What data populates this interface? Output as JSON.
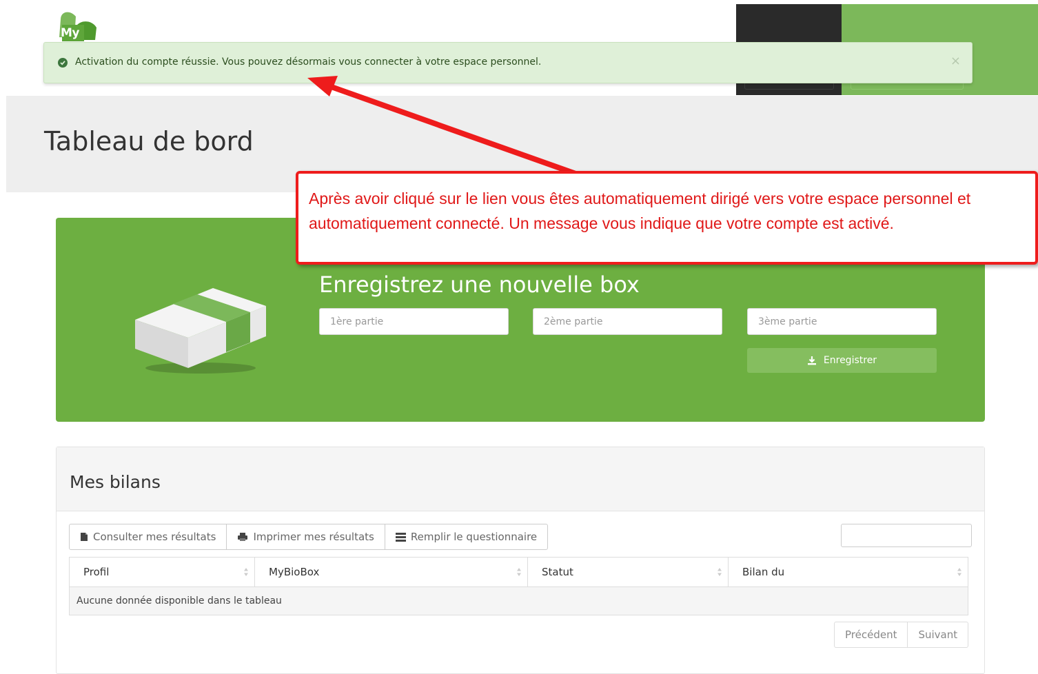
{
  "header": {
    "logo_text": "My"
  },
  "alert": {
    "icon": "check-circle-icon",
    "message": "Activation du compte réussie. Vous pouvez désormais vous connecter à votre espace personnel.",
    "close_label": "×"
  },
  "page": {
    "title": "Tableau de bord"
  },
  "register_box": {
    "title": "Enregistrez une nouvelle box",
    "inputs": [
      {
        "placeholder": "1ère partie",
        "value": ""
      },
      {
        "placeholder": "2ème partie",
        "value": ""
      },
      {
        "placeholder": "3ème partie",
        "value": ""
      }
    ],
    "submit_icon": "download-icon",
    "submit_label": "Enregistrer"
  },
  "callout": {
    "text": "Après avoir cliqué sur le lien vous êtes automatiquement dirigé vers votre espace personnel et automatiquement connecté. Un message vous indique que votre compte est activé."
  },
  "bilans": {
    "title": "Mes bilans",
    "toolbar": [
      {
        "icon": "file-icon",
        "label": "Consulter mes résultats"
      },
      {
        "icon": "print-icon",
        "label": "Imprimer mes résultats"
      },
      {
        "icon": "list-icon",
        "label": "Remplir le questionnaire"
      }
    ],
    "search_value": "",
    "columns": [
      "Profil",
      "MyBioBox",
      "Statut",
      "Bilan du"
    ],
    "empty_message": "Aucune donnée disponible dans le tableau",
    "pagination": {
      "previous": "Précédent",
      "next": "Suivant"
    }
  },
  "colors": {
    "brand_green": "#6daf41",
    "alert_bg": "#dff0d8",
    "annotation_red": "#ee1c1c"
  }
}
